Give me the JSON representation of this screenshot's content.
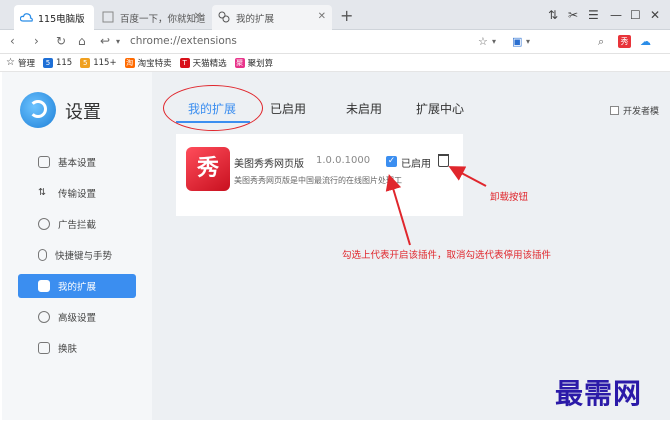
{
  "tabs": [
    {
      "title": "115电脑版"
    },
    {
      "title": "百度一下，你就知道"
    },
    {
      "title": "我的扩展"
    }
  ],
  "address": {
    "url": "chrome://extensions"
  },
  "bookmarks": [
    "管理",
    "115",
    "115+",
    "淘宝特卖",
    "天猫精选",
    "聚划算"
  ],
  "sidebar": {
    "title": "设置",
    "items": [
      {
        "label": "基本设置"
      },
      {
        "label": "传输设置"
      },
      {
        "label": "广告拦截"
      },
      {
        "label": "快捷键与手势"
      },
      {
        "label": "我的扩展"
      },
      {
        "label": "高级设置"
      },
      {
        "label": "换肤"
      }
    ]
  },
  "main": {
    "tabs": [
      "我的扩展",
      "已启用",
      "未启用",
      "扩展中心"
    ],
    "dev_mode": "开发者模",
    "extension": {
      "name": "美图秀秀网页版",
      "version": "1.0.0.1000",
      "description": "美图秀秀网页版是中国最流行的在线图片处理工",
      "enabled_label": "已启用",
      "icon_char": "秀"
    }
  },
  "annotations": {
    "uninstall": "卸载按钮",
    "checkbox_note": "勾选上代表开启该插件，取消勾选代表停用该插件"
  },
  "watermark": "最需网",
  "colors": {
    "accent": "#3b8ef0",
    "annotation": "#e0262c"
  }
}
